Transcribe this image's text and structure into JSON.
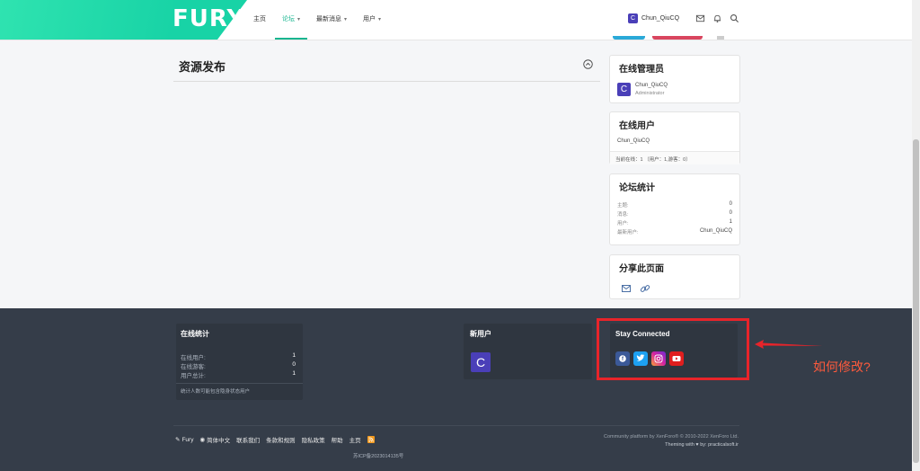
{
  "header": {
    "logo": "FURY",
    "nav": [
      {
        "label": "主页",
        "active": false,
        "caret": false
      },
      {
        "label": "论坛",
        "active": true,
        "caret": true
      },
      {
        "label": "最新消息",
        "active": false,
        "caret": true
      },
      {
        "label": "用户",
        "active": false,
        "caret": true
      }
    ],
    "user": {
      "avatar_letter": "C",
      "name": "Chun_QiuCQ"
    }
  },
  "main": {
    "section_title": "资源发布"
  },
  "sidebar": {
    "online_staff": {
      "title": "在线管理员",
      "avatar_letter": "C",
      "name": "Chun_QiuCQ",
      "role": "Administrator"
    },
    "online_users": {
      "title": "在线用户",
      "user": "Chun_QiuCQ",
      "summary": "当前在线：1 （用户：1,游客：0）"
    },
    "forum_stats": {
      "title": "论坛统计",
      "rows": [
        {
          "label": "主题:",
          "value": "0"
        },
        {
          "label": "消息:",
          "value": "0"
        },
        {
          "label": "用户:",
          "value": "1"
        },
        {
          "label": "最新用户:",
          "value": "Chun_QiuCQ"
        }
      ]
    },
    "share": {
      "title": "分享此页面"
    }
  },
  "footer": {
    "online_stats": {
      "title": "在线统计",
      "rows": [
        {
          "label": "在线用户:",
          "value": "1"
        },
        {
          "label": "在线游客:",
          "value": "0"
        },
        {
          "label": "用户总计:",
          "value": "1"
        }
      ],
      "note": "统计人数可能包含隐身状态用户"
    },
    "new_users": {
      "title": "新用户",
      "avatar_letter": "C"
    },
    "stay_connected": {
      "title": "Stay Connected"
    },
    "bottom_links": [
      "Fury",
      "简体中文",
      "联系我们",
      "条款和规则",
      "隐私政策",
      "帮助",
      "主页"
    ],
    "icp": "苏ICP备2023014135号",
    "copyright_line1": "Community platform by XenForo® © 2010-2022 XenForo Ltd.",
    "copyright_line2": "Theming with ♥ by: practicalsoft.ir"
  },
  "annotation": {
    "note": "如何修改?"
  },
  "colors": {
    "accent": "#16b58f",
    "footer_bg": "#353d49",
    "annotation_red": "#e8242a"
  }
}
